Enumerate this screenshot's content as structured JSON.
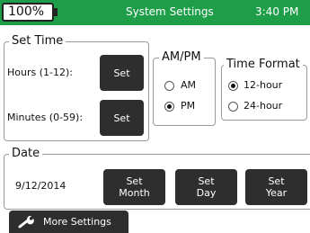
{
  "status_bar": {
    "battery": "100%",
    "title": "System Settings",
    "time": "3:40 PM"
  },
  "set_time": {
    "legend": "Set Time",
    "hours_label": "Hours (1-12):",
    "hours_button": "Set",
    "minutes_label": "Minutes (0-59):",
    "minutes_button": "Set"
  },
  "ampm": {
    "legend": "AM/PM",
    "options": [
      {
        "label": "AM",
        "selected": false
      },
      {
        "label": "PM",
        "selected": true
      }
    ]
  },
  "time_format": {
    "legend": "Time Format",
    "options": [
      {
        "label": "12-hour",
        "selected": true
      },
      {
        "label": "24-hour",
        "selected": false
      }
    ]
  },
  "date": {
    "legend": "Date",
    "value": "9/12/2014",
    "set_month": "Set\nMonth",
    "set_day": "Set\nDay",
    "set_year": "Set\nYear"
  },
  "footer": {
    "more_settings": "More Settings"
  }
}
